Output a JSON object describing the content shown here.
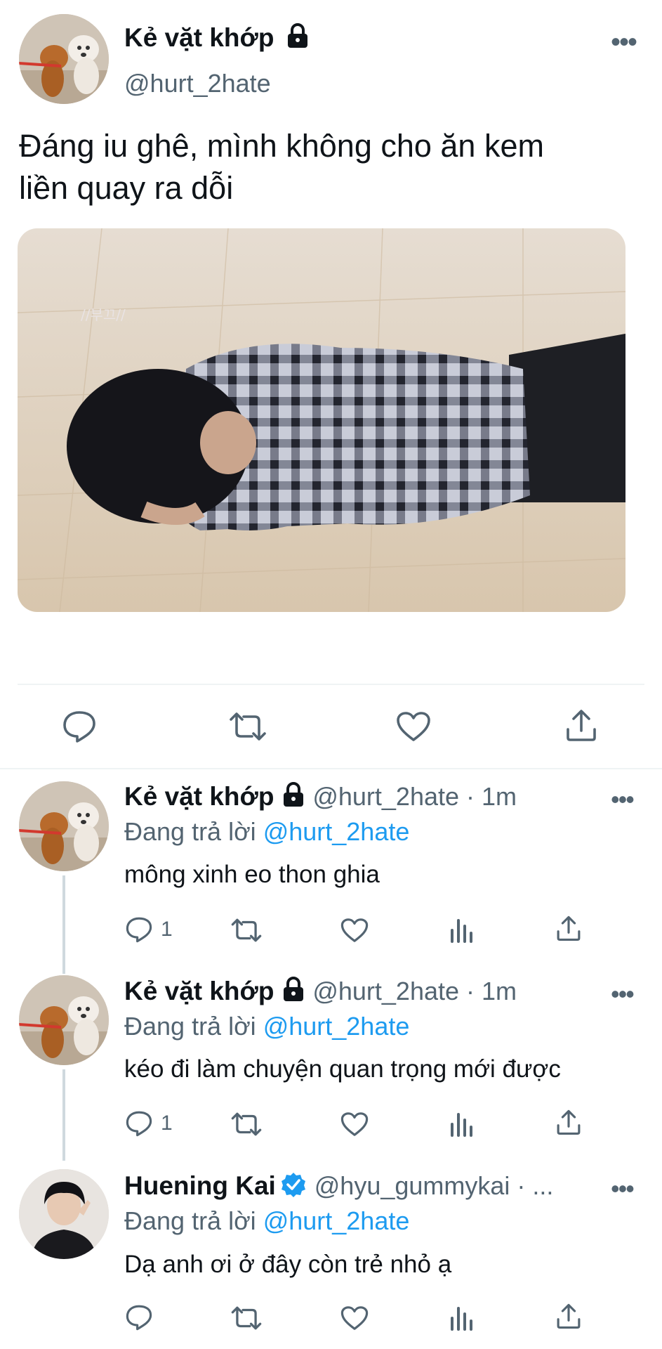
{
  "main_tweet": {
    "display_name": "Kẻ vặt khớp",
    "handle": "@hurt_2hate",
    "text_line1": "Đáng iu ghê, mình không cho ăn kem",
    "text_line2": "liền quay ra dỗi",
    "image_watermark": "//부끄//",
    "icons": [
      "reply-icon",
      "retweet-icon",
      "like-icon",
      "share-icon"
    ]
  },
  "replies": [
    {
      "display_name": "Kẻ vặt khớp",
      "handle_time": "@hurt_2hate · 1m",
      "replying_prefix": "Đang trả lời ",
      "replying_to": "@hurt_2hate",
      "text": "mông xinh eo thon ghia",
      "reply_count": "1",
      "icons": [
        "reply-icon",
        "retweet-icon",
        "like-icon",
        "analytics-icon",
        "share-icon"
      ]
    },
    {
      "display_name": "Kẻ vặt khớp",
      "handle_time": "@hurt_2hate · 1m",
      "replying_prefix": "Đang trả lời ",
      "replying_to": "@hurt_2hate",
      "text": "kéo đi làm chuyện quan trọng mới được",
      "reply_count": "1",
      "icons": [
        "reply-icon",
        "retweet-icon",
        "like-icon",
        "analytics-icon",
        "share-icon"
      ]
    },
    {
      "display_name": "Huening Kai",
      "handle_time": "@hyu_gummykai · ...",
      "replying_prefix": "Đang trả lời ",
      "replying_to": "@hurt_2hate",
      "text": "Dạ anh ơi ở đây còn trẻ nhỏ ạ",
      "reply_count": "",
      "verified": true,
      "icons": [
        "reply-icon",
        "retweet-icon",
        "like-icon",
        "analytics-icon",
        "share-icon"
      ]
    }
  ],
  "colors": {
    "link": "#1d9bf0",
    "secondary_text": "#536471",
    "verified": "#1d9bf0"
  }
}
